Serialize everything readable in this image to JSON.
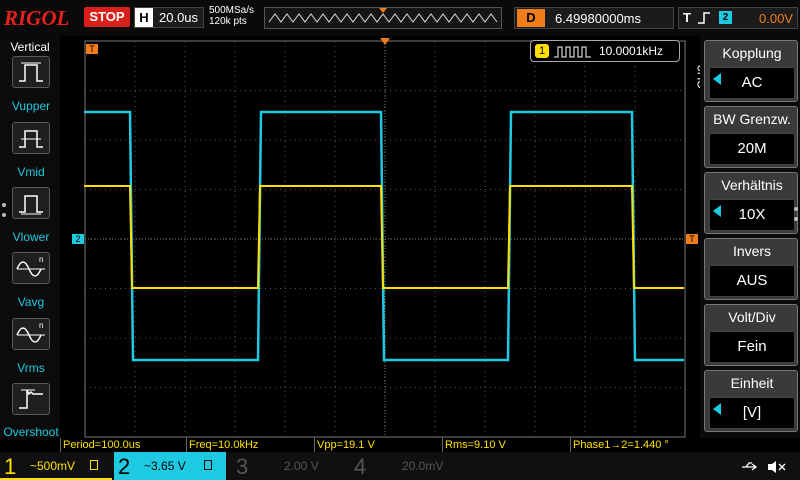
{
  "topbar": {
    "logo": "RIGOL",
    "run_state": "STOP",
    "horizontal_label": "H",
    "horizontal_value": "20.0us",
    "sample_rate": "500MSa/s",
    "memory_depth": "120k pts",
    "delay_label": "D",
    "delay_value": "6.49980000ms",
    "trigger_label": "T",
    "trigger_source": "2",
    "trigger_value": "0.00V"
  },
  "left_panel": {
    "title": "Vertical",
    "items": [
      {
        "label": "Vupper",
        "icon": "vupper-icon"
      },
      {
        "label": "Vmid",
        "icon": "vmid-icon"
      },
      {
        "label": "Vlower",
        "icon": "vlower-icon"
      },
      {
        "label": "Vavg",
        "icon": "vavg-icon"
      },
      {
        "label": "Vrms",
        "icon": "vrms-icon"
      },
      {
        "label": "Overshoot",
        "icon": "overshoot-icon"
      }
    ]
  },
  "grid": {
    "freq_counter_channel": "1",
    "freq_counter_value": "10.0001kHz",
    "ch1_marker": "1",
    "ch2_marker": "2"
  },
  "measurements": [
    {
      "text": "Period=100.0us"
    },
    {
      "text": "Freq=10.0kHz"
    },
    {
      "text": "Vpp=19.1 V"
    },
    {
      "text": "Rms=9.10 V"
    },
    {
      "text": "Phase1→2=1.440 °"
    }
  ],
  "channels": [
    {
      "num": "1",
      "value": "~500mV",
      "color": "#ffe000",
      "active": true
    },
    {
      "num": "2",
      "value": "~3.65 V",
      "color": "#1ec9e2",
      "active": true
    },
    {
      "num": "3",
      "value": "2.00 V",
      "color": "#555555",
      "active": false
    },
    {
      "num": "4",
      "value": "20.0mV",
      "color": "#555555",
      "active": false
    }
  ],
  "right_panel": {
    "channel_tag": "CH2",
    "items": [
      {
        "title": "Kopplung",
        "value": "AC"
      },
      {
        "title": "BW Grenzw.",
        "value": "20M"
      },
      {
        "title": "Verhältnis",
        "value": "10X"
      },
      {
        "title": "Invers",
        "value": "AUS"
      },
      {
        "title": "Volt/Div",
        "value": "Fein"
      },
      {
        "title": "Einheit",
        "value": "[V]"
      }
    ]
  },
  "colors": {
    "ch1": "#ffe000",
    "ch2": "#1ec9e2",
    "accent": "#f07c1a",
    "stop": "#d9201b"
  }
}
